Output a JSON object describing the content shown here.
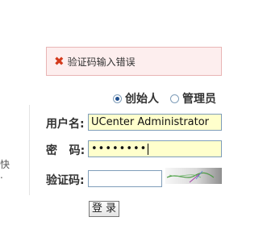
{
  "error": {
    "icon": "close-icon",
    "icon_color": "#d33a1c",
    "message": "验证码输入错误"
  },
  "roles": [
    {
      "label": "创始人",
      "selected": true
    },
    {
      "label": "管理员",
      "selected": false
    }
  ],
  "form": {
    "username_label": "用户名:",
    "username_value": "UCenter Administrator",
    "password_label": "密   码:",
    "password_value": "••••••••",
    "captcha_label": "验证码:",
    "captcha_value": "",
    "login_label": "登 录"
  },
  "left_fragments": [
    "快",
    "."
  ]
}
